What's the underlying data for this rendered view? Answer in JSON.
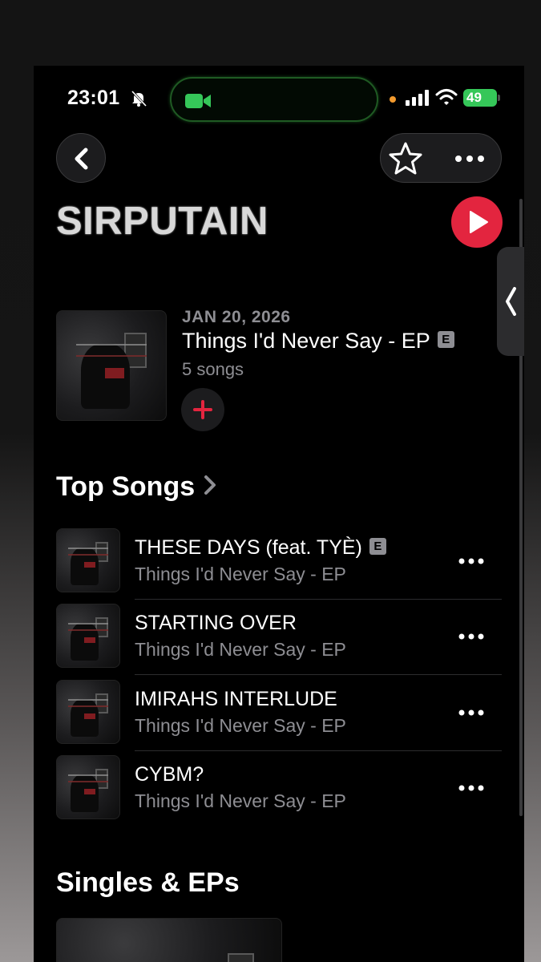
{
  "status": {
    "time": "23:01",
    "battery": "49"
  },
  "artist": {
    "name": "SIRPUTAIN"
  },
  "latest_release": {
    "date": "JAN 20, 2026",
    "title": "Things I'd Never Say - EP",
    "explicit_badge": "E",
    "count": "5 songs"
  },
  "top_songs": {
    "heading": "Top Songs",
    "items": [
      {
        "title": "THESE DAYS (feat. TYÈ)",
        "subtitle": "Things I'd Never Say - EP",
        "explicit": "E"
      },
      {
        "title": "STARTING OVER",
        "subtitle": "Things I'd Never Say - EP"
      },
      {
        "title": "IMIRAHS INTERLUDE",
        "subtitle": "Things I'd Never Say - EP"
      },
      {
        "title": "CYBM?",
        "subtitle": "Things I'd Never Say - EP"
      }
    ]
  },
  "singles": {
    "heading": "Singles & EPs"
  },
  "icons": [
    "bell-slash-icon",
    "facetime-camera-icon",
    "signal-icon",
    "wifi-icon",
    "chevron-left-icon",
    "star-icon",
    "more-icon",
    "play-icon",
    "plus-icon",
    "chevron-right-icon"
  ],
  "colors": {
    "accent": "#e3253f",
    "facetime_green": "#35c759",
    "secondary_text": "#8e8e93"
  }
}
